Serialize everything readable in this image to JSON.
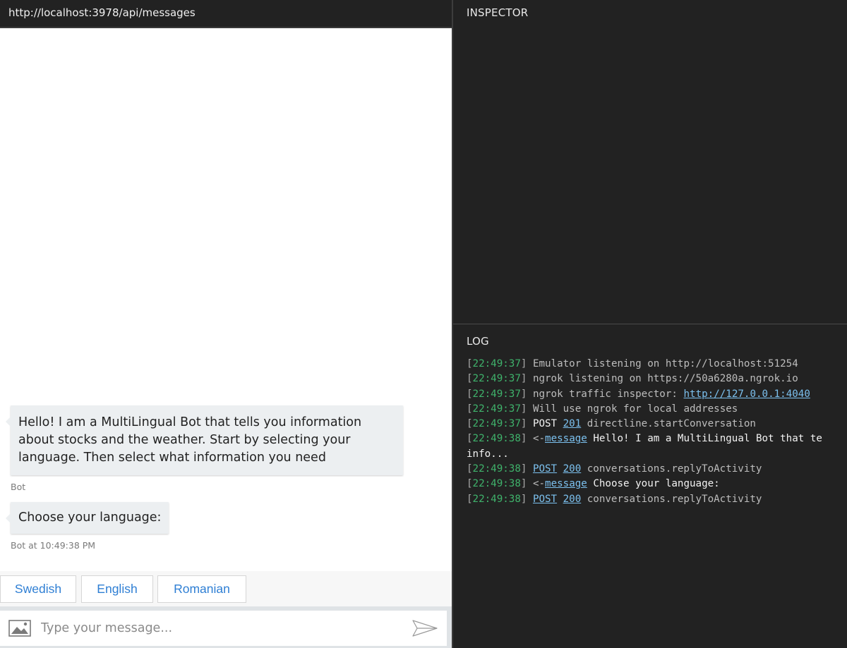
{
  "chat": {
    "endpoint_url": "http://localhost:3978/api/messages",
    "messages": [
      {
        "text": "Hello! I am a MultiLingual Bot that tells you information about stocks and the weather. Start by selecting your language. Then select what information you need",
        "meta": "Bot"
      },
      {
        "text": "Choose your language:",
        "meta": "Bot at 10:49:38 PM"
      }
    ],
    "suggested_actions": [
      "Swedish",
      "English",
      "Romanian"
    ],
    "input": {
      "value": "",
      "placeholder": "Type your message..."
    },
    "icons": {
      "upload": "image-icon",
      "send": "send-icon"
    }
  },
  "inspector": {
    "title": "INSPECTOR"
  },
  "log": {
    "title": "LOG",
    "entries": [
      {
        "time": "22:49:37",
        "parts": [
          {
            "text": "Emulator listening on http://localhost:51254",
            "style": "plain"
          }
        ]
      },
      {
        "time": "22:49:37",
        "parts": [
          {
            "text": "ngrok listening on https://50a6280a.ngrok.io",
            "style": "plain"
          }
        ]
      },
      {
        "time": "22:49:37",
        "parts": [
          {
            "text": "ngrok traffic inspector: ",
            "style": "plain"
          },
          {
            "text": "http://127.0.0.1:4040",
            "style": "link"
          }
        ]
      },
      {
        "time": "22:49:37",
        "parts": [
          {
            "text": "Will use ngrok for local addresses",
            "style": "plain"
          }
        ]
      },
      {
        "time": "22:49:37",
        "parts": [
          {
            "text": "POST",
            "style": "bright"
          },
          {
            "text": "201",
            "style": "link"
          },
          {
            "text": "directline.startConversation",
            "style": "plain"
          }
        ]
      },
      {
        "time": "22:49:38",
        "parts": [
          {
            "text": "<-",
            "style": "plain"
          },
          {
            "text": "message",
            "style": "link"
          },
          {
            "text": "Hello! I am a MultiLingual Bot that te",
            "style": "bright"
          }
        ],
        "continuation": "info..."
      },
      {
        "time": "22:49:38",
        "parts": [
          {
            "text": "POST",
            "style": "link"
          },
          {
            "text": "200",
            "style": "link"
          },
          {
            "text": "conversations.replyToActivity",
            "style": "plain"
          }
        ]
      },
      {
        "time": "22:49:38",
        "parts": [
          {
            "text": "<-",
            "style": "plain"
          },
          {
            "text": "message",
            "style": "link"
          },
          {
            "text": "Choose your language:",
            "style": "bright"
          }
        ]
      },
      {
        "time": "22:49:38",
        "parts": [
          {
            "text": "POST",
            "style": "link"
          },
          {
            "text": "200",
            "style": "link"
          },
          {
            "text": "conversations.replyToActivity",
            "style": "plain"
          }
        ]
      }
    ]
  },
  "colors": {
    "accent_blue": "#2f7fd4",
    "timestamp_green": "#3fb26b",
    "log_link": "#7cc1ef",
    "panel_dark": "#222222",
    "bubble_bg": "#eceff1"
  }
}
